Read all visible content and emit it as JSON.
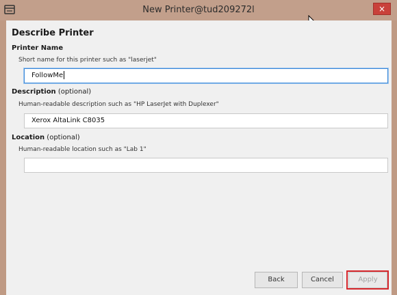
{
  "window": {
    "title": "New Printer@tud209272l",
    "close_symbol": "×",
    "icon": "printer-icon",
    "accent_color": "#c29f8b",
    "close_color": "#c9413a"
  },
  "page": {
    "heading": "Describe Printer"
  },
  "printer_name": {
    "label": "Printer Name",
    "hint": "Short name for this printer such as \"laserjet\"",
    "value": "FollowMe"
  },
  "description": {
    "label": "Description",
    "optional": " (optional)",
    "hint": "Human-readable description such as \"HP LaserJet with Duplexer\"",
    "value": "Xerox AltaLink C8035"
  },
  "location": {
    "label": "Location",
    "optional": " (optional)",
    "hint": "Human-readable location such as \"Lab 1\"",
    "value": ""
  },
  "buttons": {
    "back": "Back",
    "cancel": "Cancel",
    "apply": "Apply"
  },
  "highlight_color": "#d6252a"
}
